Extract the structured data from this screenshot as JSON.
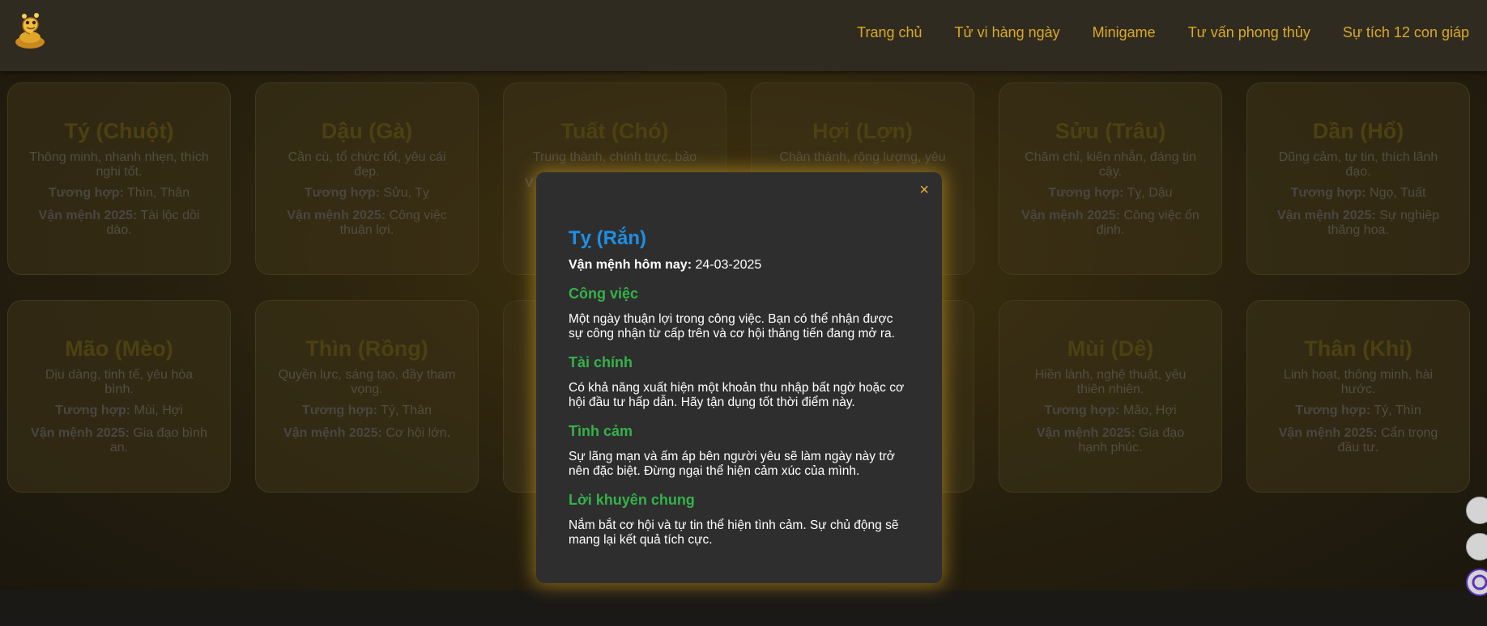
{
  "nav": {
    "items": [
      "Trang chủ",
      "Tử vi hàng ngày",
      "Minigame",
      "Tư vấn phong thủy",
      "Sự tích 12 con giáp"
    ]
  },
  "cards": [
    {
      "name": "Tý (Chuột)",
      "desc": "Thông minh, nhanh nhẹn, thích nghi tốt.",
      "compat_label": "Tương hợp:",
      "compat": "Thìn, Thân",
      "fortune_label": "Vận mệnh 2025:",
      "fortune": "Tài lộc dồi dào."
    },
    {
      "name": "Dậu (Gà)",
      "desc": "Cần cù, tổ chức tốt, yêu cái đẹp.",
      "compat_label": "Tương hợp:",
      "compat": "Sửu, Tỵ",
      "fortune_label": "Vận mệnh 2025:",
      "fortune": "Công việc thuận lợi."
    },
    {
      "name": "Tuất (Chó)",
      "desc": "Trung thành, chính trực, bảo",
      "compat_label": "",
      "compat": "",
      "fortune_label": "V",
      "fortune": ""
    },
    {
      "name": "Hợi (Lợn)",
      "desc": "Chân thành, rộng lượng, yêu",
      "compat_label": "",
      "compat": "",
      "fortune_label": "",
      "fortune": ""
    },
    {
      "name": "Sửu (Trâu)",
      "desc": "Chăm chỉ, kiên nhẫn, đáng tin cậy.",
      "compat_label": "Tương hợp:",
      "compat": "Tỵ, Dậu",
      "fortune_label": "Vận mệnh 2025:",
      "fortune": "Công việc ổn định."
    },
    {
      "name": "Dần (Hổ)",
      "desc": "Dũng cảm, tự tin, thích lãnh đạo.",
      "compat_label": "Tương hợp:",
      "compat": "Ngọ, Tuất",
      "fortune_label": "Vận mệnh 2025:",
      "fortune": "Sự nghiệp thăng hoa."
    },
    {
      "name": "Mão (Mèo)",
      "desc": "Dịu dàng, tinh tế, yêu hòa bình.",
      "compat_label": "Tương hợp:",
      "compat": "Mùi, Hợi",
      "fortune_label": "Vận mệnh 2025:",
      "fortune": "Gia đạo bình an."
    },
    {
      "name": "Thìn (Rồng)",
      "desc": "Quyền lực, sáng tạo, đầy tham vọng.",
      "compat_label": "Tương hợp:",
      "compat": "Tý, Thân",
      "fortune_label": "Vận mệnh 2025:",
      "fortune": "Cơ hội lớn."
    },
    {
      "name": "",
      "desc": "",
      "compat_label": "",
      "compat": "",
      "fortune_label": "",
      "fortune": ""
    },
    {
      "name": "",
      "desc": "",
      "compat_label": "",
      "compat": "",
      "fortune_label": "",
      "fortune": ""
    },
    {
      "name": "Mùi (Dê)",
      "desc": "Hiền lành, nghệ thuật, yêu thiên nhiên.",
      "compat_label": "Tương hợp:",
      "compat": "Mão, Hợi",
      "fortune_label": "Vận mệnh 2025:",
      "fortune": "Gia đạo hạnh phúc."
    },
    {
      "name": "Thân (Khỉ)",
      "desc": "Linh hoạt, thông minh, hài hước.",
      "compat_label": "Tương hợp:",
      "compat": "Tý, Thìn",
      "fortune_label": "Vận mệnh 2025:",
      "fortune": "Cẩn trọng đầu tư."
    }
  ],
  "modal": {
    "close": "×",
    "title": "Tỵ (Rắn)",
    "date_label": "Vận mệnh hôm nay:",
    "date": "24-03-2025",
    "sections": [
      {
        "heading": "Công việc",
        "text": "Một ngày thuận lợi trong công việc. Bạn có thể nhận được sự công nhận từ cấp trên và cơ hội thăng tiến đang mở ra."
      },
      {
        "heading": "Tài chính",
        "text": "Có khả năng xuất hiện một khoản thu nhập bất ngờ hoặc cơ hội đầu tư hấp dẫn. Hãy tận dụng tốt thời điểm này."
      },
      {
        "heading": "Tình cảm",
        "text": "Sự lãng mạn và ấm áp bên người yêu sẽ làm ngày này trở nên đặc biệt. Đừng ngại thể hiện cảm xúc của mình."
      },
      {
        "heading": "Lời khuyên chung",
        "text": "Nắm bắt cơ hội và tự tin thể hiện tình cảm. Sự chủ động sẽ mang lại kết quả tích cực."
      }
    ]
  },
  "colors": {
    "nav_text": "#d9a92a",
    "modal_title": "#1e8fe6",
    "section_heading": "#35b24a",
    "modal_glow": "#d6a428"
  }
}
